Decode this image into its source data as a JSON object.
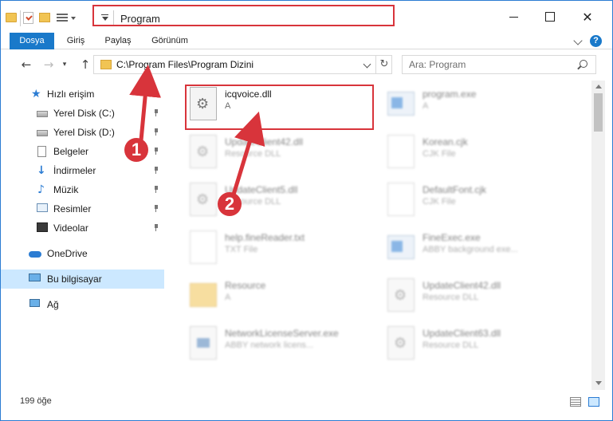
{
  "window": {
    "title": "Program"
  },
  "ribbon": {
    "tabs": [
      {
        "label": "Dosya"
      },
      {
        "label": "Giriş"
      },
      {
        "label": "Paylaş"
      },
      {
        "label": "Görünüm"
      }
    ],
    "help": "?"
  },
  "nav": {
    "address": "C:\\Program Files\\Program Dizini",
    "search_placeholder": "Ara: Program"
  },
  "sidebar": {
    "items": [
      {
        "label": "Hızlı erişim",
        "icon": "star-icon"
      },
      {
        "label": "Yerel Disk (C:)",
        "icon": "drive-icon"
      },
      {
        "label": "Yerel Disk (D:)",
        "icon": "drive-icon"
      },
      {
        "label": "Belgeler",
        "icon": "documents-icon"
      },
      {
        "label": "İndirmeler",
        "icon": "downloads-icon"
      },
      {
        "label": "Müzik",
        "icon": "music-icon"
      },
      {
        "label": "Resimler",
        "icon": "pictures-icon"
      },
      {
        "label": "Videolar",
        "icon": "videos-icon"
      },
      {
        "label": "OneDrive",
        "icon": "onedrive-icon"
      },
      {
        "label": "Bu bilgisayar",
        "icon": "this-pc-icon"
      },
      {
        "label": "Ağ",
        "icon": "network-icon"
      }
    ]
  },
  "files": [
    {
      "name": "icqvoice.dll",
      "type": "A",
      "icon": "dll-icon"
    },
    {
      "name": "program.exe",
      "type": "A",
      "icon": "exe-icon"
    },
    {
      "name": "UpdateClient42.dll",
      "type": "Resource DLL",
      "icon": "dll-icon"
    },
    {
      "name": "Korean.cjk",
      "type": "CJK File",
      "icon": "document-icon"
    },
    {
      "name": "UpdateClient5.dll",
      "type": "Resource DLL",
      "icon": "dll-icon"
    },
    {
      "name": "DefaultFont.cjk",
      "type": "CJK File",
      "icon": "document-icon"
    },
    {
      "name": "help.fineReader.txt",
      "type": "TXT File",
      "icon": "document-icon"
    },
    {
      "name": "FineExec.exe",
      "type": "ABBY background exe...",
      "icon": "exe-icon"
    },
    {
      "name": "Resource",
      "type": "A",
      "icon": "folder-icon"
    },
    {
      "name": "UpdateClient42.dll",
      "type": "Resource DLL",
      "icon": "dll-icon"
    },
    {
      "name": "NetworkLicenseServer.exe",
      "type": "ABBY network licens...",
      "icon": "app-icon"
    },
    {
      "name": "UpdateClient63.dll",
      "type": "Resource DLL",
      "icon": "dll-icon"
    }
  ],
  "status": {
    "count": "199 öğe"
  },
  "callouts": {
    "one": "1",
    "two": "2"
  },
  "colors": {
    "accent": "#1979ca",
    "highlight": "#d8343b",
    "selected": "#cce8ff"
  }
}
